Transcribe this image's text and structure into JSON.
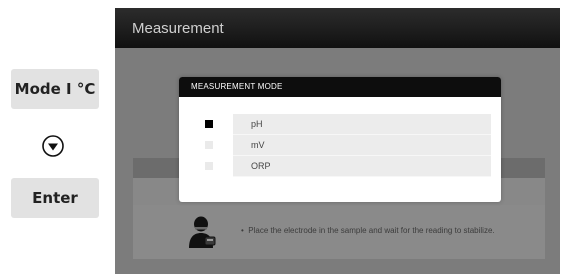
{
  "side_buttons": {
    "mode_label": "Mode I °C",
    "down_icon": "down-arrow-circle-icon",
    "enter_label": "Enter"
  },
  "screen": {
    "title": "Measurement",
    "hint_icon": "user-with-electrode-icon",
    "hint_text": "Place the electrode in the sample and wait for the reading to stabilize."
  },
  "dialog": {
    "title": "MEASUREMENT MODE",
    "options": [
      {
        "label": "pH",
        "selected": true
      },
      {
        "label": "mV",
        "selected": false
      },
      {
        "label": "ORP",
        "selected": false
      }
    ]
  }
}
